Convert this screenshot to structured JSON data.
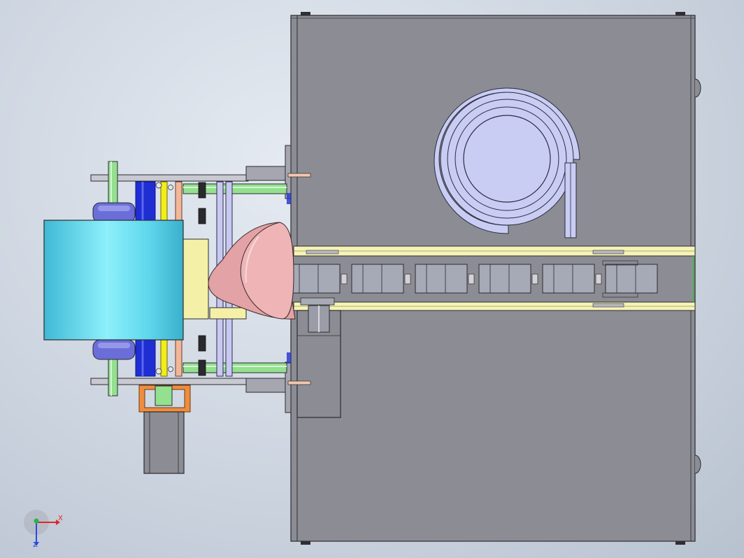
{
  "colors": {
    "background_top": "#e6ebf2",
    "background_bottom": "#b8c2cf",
    "housing": "#8c8d94",
    "conveyor_rail": "#f5f3b6",
    "roll": "#6fd9ee",
    "bowl_feeder": "#c9cdf3",
    "funnel": "#e3a2a5",
    "rod_green": "#93e08f",
    "roller_blue": "#1f2ed3",
    "belt_yellow": "#f2ee18",
    "bracket_orange": "#ef8d3e",
    "part_gray": "#a6a9b6",
    "axis_x": "#e0262a",
    "axis_y": "#22b84a",
    "axis_z": "#2b4ae0"
  },
  "conveyor": {
    "parts_count": 6
  },
  "triad": {
    "x_label": "X",
    "z_label": "Z"
  }
}
